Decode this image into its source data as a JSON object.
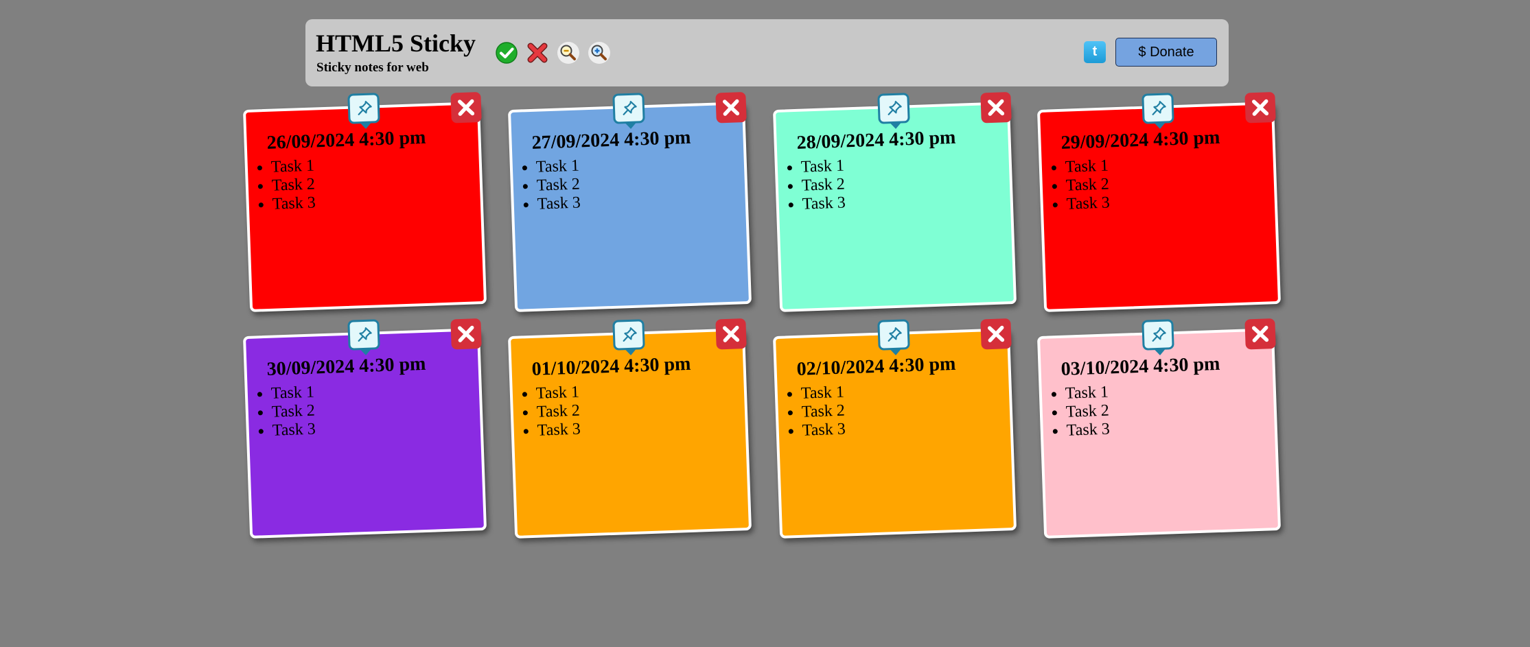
{
  "header": {
    "title": "HTML5 Sticky",
    "subtitle": "Sticky notes for web",
    "tools": [
      {
        "name": "save",
        "icon": "check-circle-icon"
      },
      {
        "name": "clear",
        "icon": "red-x-icon"
      },
      {
        "name": "zoom-out",
        "icon": "zoom-out-icon"
      },
      {
        "name": "zoom-in",
        "icon": "zoom-in-icon"
      }
    ],
    "twitter_label": "t",
    "donate_label": "$ Donate"
  },
  "colors": {
    "background": "#808080",
    "header": "#c8c8c8",
    "pin": "#1f7fa3",
    "close": "#d52f3a"
  },
  "notes": [
    {
      "title": "26/09/2024 4:30 pm",
      "color": "#ff0000",
      "tasks": [
        "Task 1",
        "Task 2",
        "Task 3"
      ]
    },
    {
      "title": "27/09/2024 4:30 pm",
      "color": "#71a5e1",
      "tasks": [
        "Task 1",
        "Task 2",
        "Task 3"
      ]
    },
    {
      "title": "28/09/2024 4:30 pm",
      "color": "#7fffd4",
      "tasks": [
        "Task 1",
        "Task 2",
        "Task 3"
      ]
    },
    {
      "title": "29/09/2024 4:30 pm",
      "color": "#ff0000",
      "tasks": [
        "Task 1",
        "Task 2",
        "Task 3"
      ]
    },
    {
      "title": "30/09/2024 4:30 pm",
      "color": "#8a2be2",
      "tasks": [
        "Task 1",
        "Task 2",
        "Task 3"
      ]
    },
    {
      "title": "01/10/2024 4:30 pm",
      "color": "#ffa500",
      "tasks": [
        "Task 1",
        "Task 2",
        "Task 3"
      ]
    },
    {
      "title": "02/10/2024 4:30 pm",
      "color": "#ffa500",
      "tasks": [
        "Task 1",
        "Task 2",
        "Task 3"
      ]
    },
    {
      "title": "03/10/2024 4:30 pm",
      "color": "#ffc0cb",
      "tasks": [
        "Task 1",
        "Task 2",
        "Task 3"
      ]
    }
  ]
}
